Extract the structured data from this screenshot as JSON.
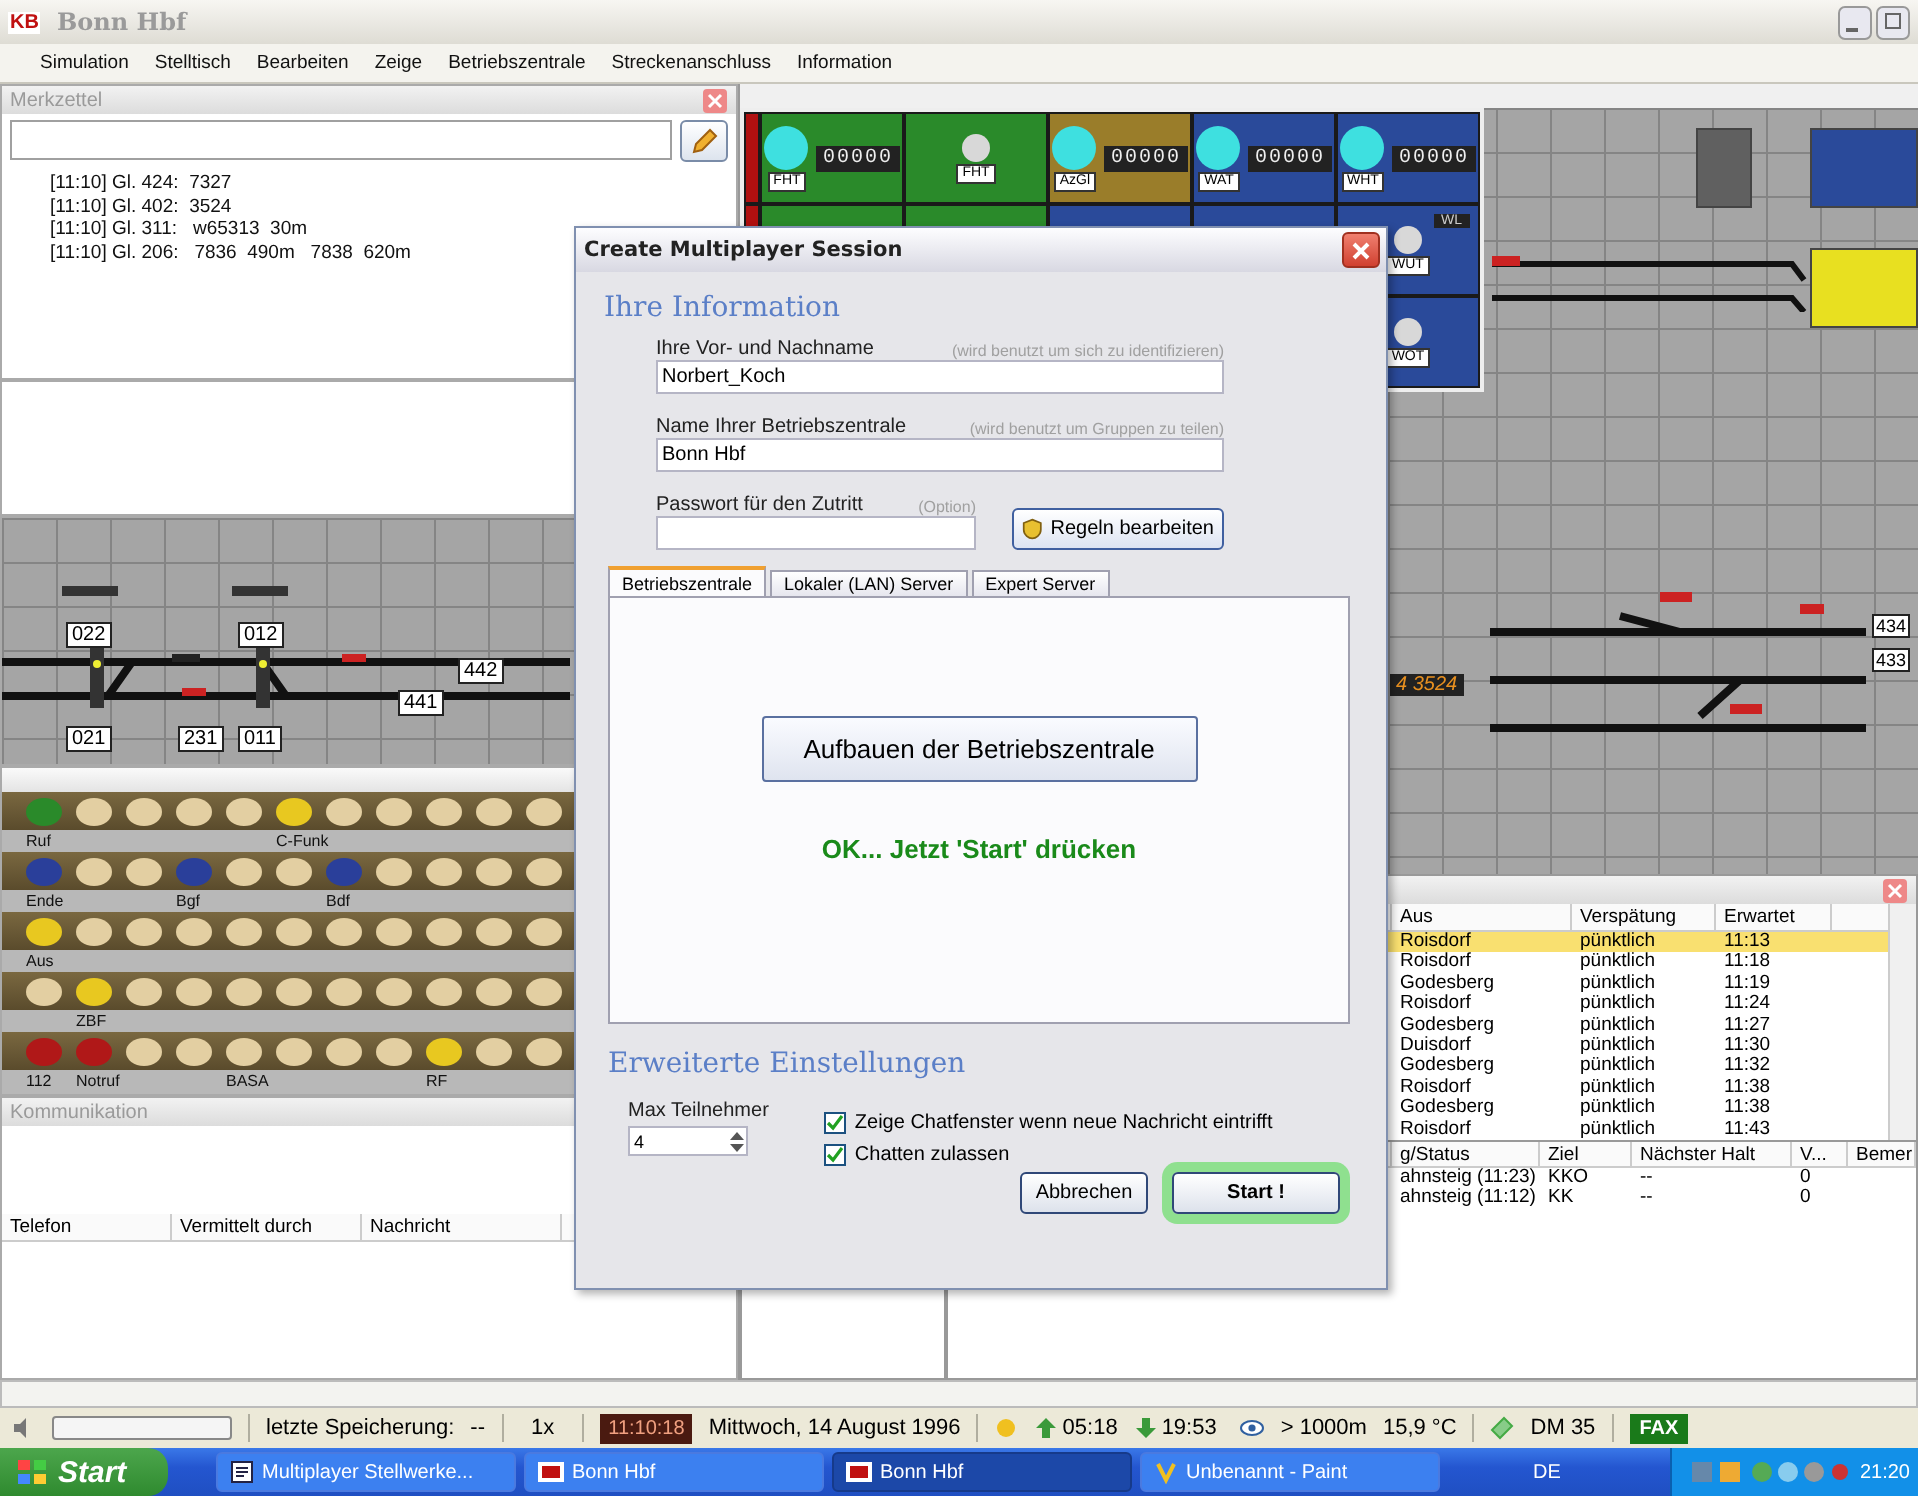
{
  "window": {
    "logo": "KB",
    "title": "Bonn Hbf"
  },
  "menu": [
    "Simulation",
    "Stelltisch",
    "Bearbeiten",
    "Zeige",
    "Betriebszentrale",
    "Streckenanschluss",
    "Information"
  ],
  "notepad": {
    "title": "Merkzettel",
    "notes": [
      {
        "time": "[11:10]",
        "track": "Gl. 424:",
        "text": "7327"
      },
      {
        "time": "[11:10]",
        "track": "Gl. 402:",
        "text": "3524"
      },
      {
        "time": "[11:10]",
        "track": "Gl. 311:",
        "text": " w65313  30m"
      },
      {
        "time": "[11:10]",
        "track": "Gl. 206:",
        "text": " 7836  490m   7838  620m"
      }
    ]
  },
  "track_diagram": {
    "labels": [
      "022",
      "012",
      "021",
      "231",
      "011",
      "442",
      "441"
    ]
  },
  "signal_panel": {
    "cells": [
      {
        "kind": "counter",
        "label": "FHT",
        "counter": "00000",
        "color": "#2a8a2a"
      },
      {
        "kind": "lamp",
        "label": "FHT",
        "color": "#2a8a2a"
      },
      {
        "kind": "counter",
        "label": "AzGl",
        "counter": "00000",
        "color": "#9a7d2a"
      },
      {
        "kind": "counter",
        "label": "WAT",
        "counter": "00000",
        "color": "#2a4a9a"
      },
      {
        "kind": "counter",
        "label": "WHT",
        "counter": "00000",
        "color": "#2a4a9a"
      },
      {
        "kind": "lamp",
        "label": "WUT",
        "tag": "WL",
        "color": "#2a4a9a"
      },
      {
        "kind": "lamp",
        "label": "WOT",
        "color": "#2a4a9a"
      }
    ]
  },
  "station_canvas": {
    "labels": [
      "434",
      "433"
    ],
    "display": "4 3524"
  },
  "phone_panel": {
    "rows": [
      {
        "lamps": [
          {
            "color": "#2a8a2a",
            "label": "Ruf"
          },
          {
            "color": "#e3cfa2"
          },
          {
            "color": "#e3cfa2"
          },
          {
            "color": "#e3cfa2"
          },
          {
            "color": "#e3cfa2"
          },
          {
            "color": "#e8c820",
            "label": "C-Funk"
          },
          {
            "color": "#e3cfa2"
          },
          {
            "color": "#e3cfa2"
          },
          {
            "color": "#e3cfa2"
          },
          {
            "color": "#e3cfa2"
          },
          {
            "color": "#e3cfa2"
          }
        ]
      },
      {
        "lamps": [
          {
            "color": "#2a3f9a",
            "label": "Ende"
          },
          {
            "color": "#e3cfa2"
          },
          {
            "color": "#e3cfa2"
          },
          {
            "color": "#2a3f9a",
            "label": "Bgf"
          },
          {
            "color": "#e3cfa2"
          },
          {
            "color": "#e3cfa2"
          },
          {
            "color": "#2a3f9a",
            "label": "Bdf"
          },
          {
            "color": "#e3cfa2"
          },
          {
            "color": "#e3cfa2"
          },
          {
            "color": "#e3cfa2"
          },
          {
            "color": "#e3cfa2"
          }
        ]
      },
      {
        "lamps": [
          {
            "color": "#e8c820",
            "label": "Aus"
          },
          {
            "color": "#e3cfa2"
          },
          {
            "color": "#e3cfa2"
          },
          {
            "color": "#e3cfa2"
          },
          {
            "color": "#e3cfa2"
          },
          {
            "color": "#e3cfa2"
          },
          {
            "color": "#e3cfa2"
          },
          {
            "color": "#e3cfa2"
          },
          {
            "color": "#e3cfa2"
          },
          {
            "color": "#e3cfa2"
          },
          {
            "color": "#e3cfa2"
          }
        ]
      },
      {
        "lamps": [
          {
            "color": "#e3cfa2"
          },
          {
            "color": "#e8c820",
            "label": "ZBF"
          },
          {
            "color": "#e3cfa2"
          },
          {
            "color": "#e3cfa2"
          },
          {
            "color": "#e3cfa2"
          },
          {
            "color": "#e3cfa2"
          },
          {
            "color": "#e3cfa2"
          },
          {
            "color": "#e3cfa2"
          },
          {
            "color": "#e3cfa2"
          },
          {
            "color": "#e3cfa2"
          },
          {
            "color": "#e3cfa2"
          }
        ]
      },
      {
        "lamps": [
          {
            "color": "#b01818",
            "label": "112"
          },
          {
            "color": "#b01818",
            "label": "Notruf"
          },
          {
            "color": "#e3cfa2"
          },
          {
            "color": "#e3cfa2"
          },
          {
            "color": "#e3cfa2",
            "label": "BASA"
          },
          {
            "color": "#e3cfa2"
          },
          {
            "color": "#e3cfa2"
          },
          {
            "color": "#e3cfa2"
          },
          {
            "color": "#e8c820",
            "label": "RF"
          },
          {
            "color": "#e3cfa2"
          },
          {
            "color": "#e3cfa2"
          }
        ]
      }
    ]
  },
  "communication": {
    "title": "Kommunikation",
    "columns": [
      "Telefon",
      "Vermittelt durch",
      "Nachricht"
    ]
  },
  "arrivals_table": {
    "columns": [
      "Aus",
      "Verspätung",
      "Erwartet"
    ],
    "rows": [
      {
        "cells": [
          "Roisdorf",
          "pünktlich",
          "11:13"
        ],
        "selected": true
      },
      {
        "cells": [
          "Roisdorf",
          "pünktlich",
          "11:18"
        ],
        "selected": false
      },
      {
        "cells": [
          "Godesberg",
          "pünktlich",
          "11:19"
        ],
        "selected": false
      },
      {
        "cells": [
          "Roisdorf",
          "pünktlich",
          "11:24"
        ],
        "selected": false
      },
      {
        "cells": [
          "Godesberg",
          "pünktlich",
          "11:27"
        ],
        "selected": false
      },
      {
        "cells": [
          "Duisdorf",
          "pünktlich",
          "11:30"
        ],
        "selected": false
      },
      {
        "cells": [
          "Godesberg",
          "pünktlich",
          "11:32"
        ],
        "selected": false
      },
      {
        "cells": [
          "Roisdorf",
          "pünktlich",
          "11:38"
        ],
        "selected": false
      },
      {
        "cells": [
          "Godesberg",
          "pünktlich",
          "11:38"
        ],
        "selected": false
      },
      {
        "cells": [
          "Roisdorf",
          "pünktlich",
          "11:43"
        ],
        "selected": false
      }
    ]
  },
  "trains_table": {
    "columns": [
      "g/Status",
      "Ziel",
      "Nächster Halt",
      "V...",
      "Bemer"
    ],
    "rows": [
      [
        "ahnsteig (11:23)",
        "KKO",
        "--",
        "0"
      ],
      [
        "ahnsteig (11:12)",
        "KK",
        "--",
        "0"
      ]
    ]
  },
  "dialog": {
    "title": "Create Multiplayer Session",
    "section": "Ihre Information",
    "fields": [
      {
        "label": "Ihre Vor- und Nachname",
        "hint": "(wird benutzt um sich zu identifizieren)",
        "value": "Norbert_Koch"
      },
      {
        "label": "Name Ihrer Betriebszentrale",
        "hint": "(wird benutzt um Gruppen zu teilen)",
        "value": "Bonn Hbf"
      },
      {
        "label": "Passwort für den Zutritt",
        "hint": "(Option)"
      }
    ],
    "rules_button": "Regeln bearbeiten",
    "tabs": [
      {
        "label": "Betriebszentrale",
        "selected": true
      },
      {
        "label": "Lokaler (LAN) Server",
        "selected": false
      },
      {
        "label": "Expert Server",
        "selected": false
      }
    ],
    "build_button": "Aufbauen der Betriebszentrale",
    "message": "OK... Jetzt 'Start' drücken",
    "advanced": "Erweiterte Einstellungen",
    "max_label": "Max Teilnehmer",
    "max_value": "4",
    "checkboxes": [
      {
        "label": "Zeige Chatfenster wenn neue Nachricht eintrifft",
        "checked": true
      },
      {
        "label": "Chatten zulassen",
        "checked": true
      }
    ],
    "buttons": [
      {
        "label": "Abbrechen",
        "kind": "normal"
      },
      {
        "label": "Start !",
        "kind": "primary"
      }
    ]
  },
  "status_bar": {
    "level": 0,
    "save_label": "letzte Speicherung:",
    "save_value": "--",
    "speed": "1x",
    "clock": "11:10:18",
    "date": "Mittwoch, 14 August 1996",
    "sunrise": "05:18",
    "sunset": "19:53",
    "visibility": "> 1000m",
    "temperature": "15,9 °C",
    "money": "DM 35",
    "fax": "FAX"
  },
  "taskbar": {
    "start": "Start",
    "items": [
      {
        "label": "Multiplayer Stellwerke...",
        "kind": "doc",
        "selected": false
      },
      {
        "label": "Bonn Hbf",
        "kind": "app",
        "selected": false
      },
      {
        "label": "Bonn Hbf",
        "kind": "app",
        "selected": true
      },
      {
        "label": "Unbenannt - Paint",
        "kind": "paint",
        "selected": false
      }
    ],
    "language": "DE",
    "clock": "21:20"
  }
}
